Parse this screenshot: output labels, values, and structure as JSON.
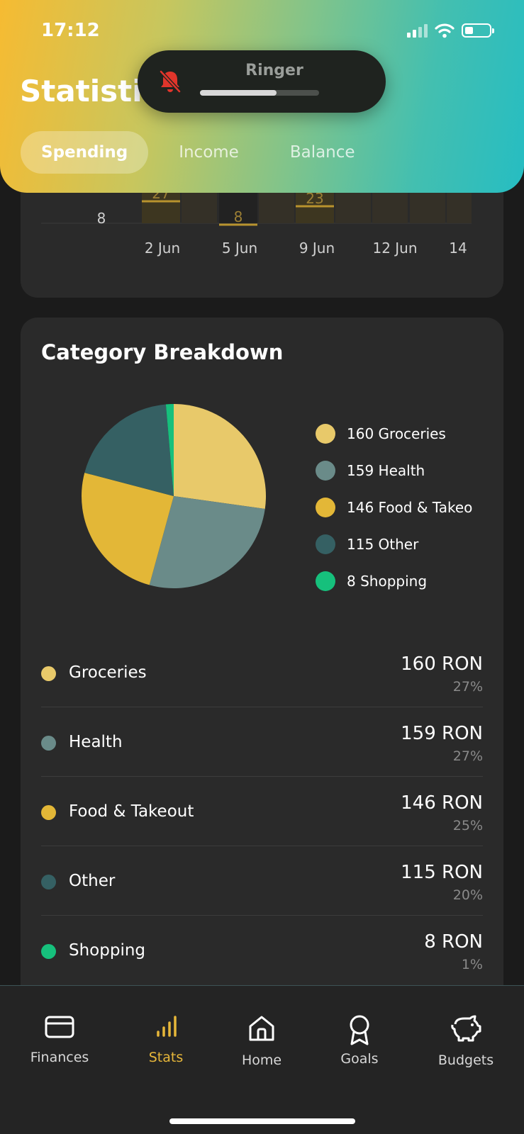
{
  "status_bar": {
    "time": "17:12"
  },
  "header": {
    "title": "Statistics"
  },
  "tabs": [
    {
      "label": "Spending",
      "active": true
    },
    {
      "label": "Income",
      "active": false
    },
    {
      "label": "Balance",
      "active": false
    }
  ],
  "ringer": {
    "label": "Ringer",
    "level": 0.64,
    "icon": "bell-slash-icon"
  },
  "daily_chart": {
    "type": "bar",
    "visible_bar_labels": [
      "27",
      "8",
      "23"
    ],
    "left_value_label": "8",
    "x_ticks": [
      "2 Jun",
      "5 Jun",
      "9 Jun",
      "12 Jun",
      "14"
    ]
  },
  "category_breakdown": {
    "title": "Category Breakdown",
    "legend": [
      {
        "label": "160 Groceries",
        "color": "#e8c96a"
      },
      {
        "label": "159 Health",
        "color": "#6a8b89"
      },
      {
        "label": "146 Food & Takeo",
        "color": "#e3b737"
      },
      {
        "label": "115 Other",
        "color": "#356063"
      },
      {
        "label": "8 Shopping",
        "color": "#16c07c"
      }
    ],
    "rows": [
      {
        "name": "Groceries",
        "amount": "160 RON",
        "percent": "27%",
        "color": "#e8c96a"
      },
      {
        "name": "Health",
        "amount": "159 RON",
        "percent": "27%",
        "color": "#6a8b89"
      },
      {
        "name": "Food & Takeout",
        "amount": "146 RON",
        "percent": "25%",
        "color": "#e3b737"
      },
      {
        "name": "Other",
        "amount": "115 RON",
        "percent": "20%",
        "color": "#356063"
      },
      {
        "name": "Shopping",
        "amount": "8 RON",
        "percent": "1%",
        "color": "#16c07c"
      }
    ]
  },
  "chart_data": {
    "type": "pie",
    "categories": [
      "Groceries",
      "Health",
      "Food & Takeout",
      "Other",
      "Shopping"
    ],
    "values": [
      160,
      159,
      146,
      115,
      8
    ],
    "colors": [
      "#e8c96a",
      "#6a8b89",
      "#e3b737",
      "#356063",
      "#16c07c"
    ]
  },
  "nav": [
    {
      "label": "Finances",
      "icon": "credit-card-icon",
      "active": false
    },
    {
      "label": "Stats",
      "icon": "bar-chart-icon",
      "active": true
    },
    {
      "label": "Home",
      "icon": "home-icon",
      "active": false
    },
    {
      "label": "Goals",
      "icon": "award-icon",
      "active": false
    },
    {
      "label": "Budgets",
      "icon": "piggy-bank-icon",
      "active": false
    }
  ]
}
